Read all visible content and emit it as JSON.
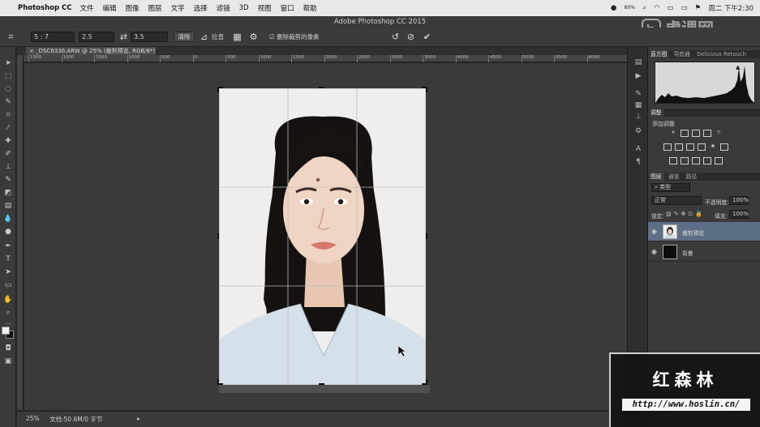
{
  "menubar": {
    "app": "Photoshop CC",
    "items": [
      "文件",
      "编辑",
      "图像",
      "图层",
      "文字",
      "选择",
      "滤镜",
      "3D",
      "视图",
      "窗口",
      "帮助"
    ],
    "status_pct": "80%",
    "clock": "周二 下午2:30"
  },
  "window": {
    "title": "Adobe Photoshop CC 2015"
  },
  "options": {
    "ratio": "5 : 7",
    "width": "2.5",
    "height": "3.5",
    "clear_label": "清除",
    "straighten_label": "拉直",
    "delete_cropped_label": "删除裁剪的像素",
    "delete_cropped_checked": true
  },
  "document": {
    "tab_title": "_DSC6336.ARW @ 25% (裁剪预览, RGB/8*) *",
    "zoom": "25%",
    "doc_info": "文档:50.6M/0 字节"
  },
  "ruler": {
    "top_ticks": [
      "1500",
      "1000",
      "1500",
      "1000",
      "500",
      "0",
      "500",
      "1000",
      "1500",
      "2000",
      "2500",
      "3000",
      "3500",
      "4000",
      "4500",
      "5000",
      "5500",
      "6000"
    ]
  },
  "panels": {
    "histogram_tabs": [
      "直方图",
      "导航器",
      "Delicious Retouch"
    ],
    "adjust_tab": "调整",
    "adjust_title": "添加调整",
    "layer_tabs": [
      "图层",
      "通道",
      "路径"
    ],
    "kind_filter": "类型",
    "blend_mode": "正常",
    "opacity_label": "不透明度:",
    "opacity_value": "100%",
    "lock_label": "锁定:",
    "fill_label": "填充:",
    "fill_value": "100%",
    "layers": [
      {
        "name": "裁剪预览",
        "selected": true
      },
      {
        "name": "背景",
        "selected": false
      }
    ]
  },
  "watermark": {
    "name": "红森林",
    "url": "http://www.hoslin.cn/",
    "logo": "虎课网"
  }
}
